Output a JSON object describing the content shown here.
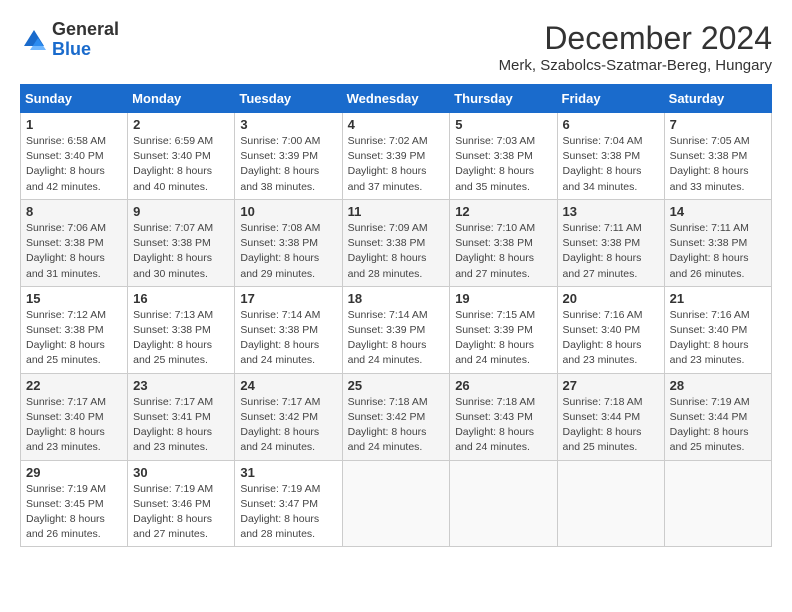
{
  "header": {
    "logo_line1": "General",
    "logo_line2": "Blue",
    "month": "December 2024",
    "location": "Merk, Szabolcs-Szatmar-Bereg, Hungary"
  },
  "weekdays": [
    "Sunday",
    "Monday",
    "Tuesday",
    "Wednesday",
    "Thursday",
    "Friday",
    "Saturday"
  ],
  "weeks": [
    [
      {
        "day": "1",
        "sunrise": "6:58 AM",
        "sunset": "3:40 PM",
        "daylight": "8 hours and 42 minutes."
      },
      {
        "day": "2",
        "sunrise": "6:59 AM",
        "sunset": "3:40 PM",
        "daylight": "8 hours and 40 minutes."
      },
      {
        "day": "3",
        "sunrise": "7:00 AM",
        "sunset": "3:39 PM",
        "daylight": "8 hours and 38 minutes."
      },
      {
        "day": "4",
        "sunrise": "7:02 AM",
        "sunset": "3:39 PM",
        "daylight": "8 hours and 37 minutes."
      },
      {
        "day": "5",
        "sunrise": "7:03 AM",
        "sunset": "3:38 PM",
        "daylight": "8 hours and 35 minutes."
      },
      {
        "day": "6",
        "sunrise": "7:04 AM",
        "sunset": "3:38 PM",
        "daylight": "8 hours and 34 minutes."
      },
      {
        "day": "7",
        "sunrise": "7:05 AM",
        "sunset": "3:38 PM",
        "daylight": "8 hours and 33 minutes."
      }
    ],
    [
      {
        "day": "8",
        "sunrise": "7:06 AM",
        "sunset": "3:38 PM",
        "daylight": "8 hours and 31 minutes."
      },
      {
        "day": "9",
        "sunrise": "7:07 AM",
        "sunset": "3:38 PM",
        "daylight": "8 hours and 30 minutes."
      },
      {
        "day": "10",
        "sunrise": "7:08 AM",
        "sunset": "3:38 PM",
        "daylight": "8 hours and 29 minutes."
      },
      {
        "day": "11",
        "sunrise": "7:09 AM",
        "sunset": "3:38 PM",
        "daylight": "8 hours and 28 minutes."
      },
      {
        "day": "12",
        "sunrise": "7:10 AM",
        "sunset": "3:38 PM",
        "daylight": "8 hours and 27 minutes."
      },
      {
        "day": "13",
        "sunrise": "7:11 AM",
        "sunset": "3:38 PM",
        "daylight": "8 hours and 27 minutes."
      },
      {
        "day": "14",
        "sunrise": "7:11 AM",
        "sunset": "3:38 PM",
        "daylight": "8 hours and 26 minutes."
      }
    ],
    [
      {
        "day": "15",
        "sunrise": "7:12 AM",
        "sunset": "3:38 PM",
        "daylight": "8 hours and 25 minutes."
      },
      {
        "day": "16",
        "sunrise": "7:13 AM",
        "sunset": "3:38 PM",
        "daylight": "8 hours and 25 minutes."
      },
      {
        "day": "17",
        "sunrise": "7:14 AM",
        "sunset": "3:38 PM",
        "daylight": "8 hours and 24 minutes."
      },
      {
        "day": "18",
        "sunrise": "7:14 AM",
        "sunset": "3:39 PM",
        "daylight": "8 hours and 24 minutes."
      },
      {
        "day": "19",
        "sunrise": "7:15 AM",
        "sunset": "3:39 PM",
        "daylight": "8 hours and 24 minutes."
      },
      {
        "day": "20",
        "sunrise": "7:16 AM",
        "sunset": "3:40 PM",
        "daylight": "8 hours and 23 minutes."
      },
      {
        "day": "21",
        "sunrise": "7:16 AM",
        "sunset": "3:40 PM",
        "daylight": "8 hours and 23 minutes."
      }
    ],
    [
      {
        "day": "22",
        "sunrise": "7:17 AM",
        "sunset": "3:40 PM",
        "daylight": "8 hours and 23 minutes."
      },
      {
        "day": "23",
        "sunrise": "7:17 AM",
        "sunset": "3:41 PM",
        "daylight": "8 hours and 23 minutes."
      },
      {
        "day": "24",
        "sunrise": "7:17 AM",
        "sunset": "3:42 PM",
        "daylight": "8 hours and 24 minutes."
      },
      {
        "day": "25",
        "sunrise": "7:18 AM",
        "sunset": "3:42 PM",
        "daylight": "8 hours and 24 minutes."
      },
      {
        "day": "26",
        "sunrise": "7:18 AM",
        "sunset": "3:43 PM",
        "daylight": "8 hours and 24 minutes."
      },
      {
        "day": "27",
        "sunrise": "7:18 AM",
        "sunset": "3:44 PM",
        "daylight": "8 hours and 25 minutes."
      },
      {
        "day": "28",
        "sunrise": "7:19 AM",
        "sunset": "3:44 PM",
        "daylight": "8 hours and 25 minutes."
      }
    ],
    [
      {
        "day": "29",
        "sunrise": "7:19 AM",
        "sunset": "3:45 PM",
        "daylight": "8 hours and 26 minutes."
      },
      {
        "day": "30",
        "sunrise": "7:19 AM",
        "sunset": "3:46 PM",
        "daylight": "8 hours and 27 minutes."
      },
      {
        "day": "31",
        "sunrise": "7:19 AM",
        "sunset": "3:47 PM",
        "daylight": "8 hours and 28 minutes."
      },
      null,
      null,
      null,
      null
    ]
  ]
}
